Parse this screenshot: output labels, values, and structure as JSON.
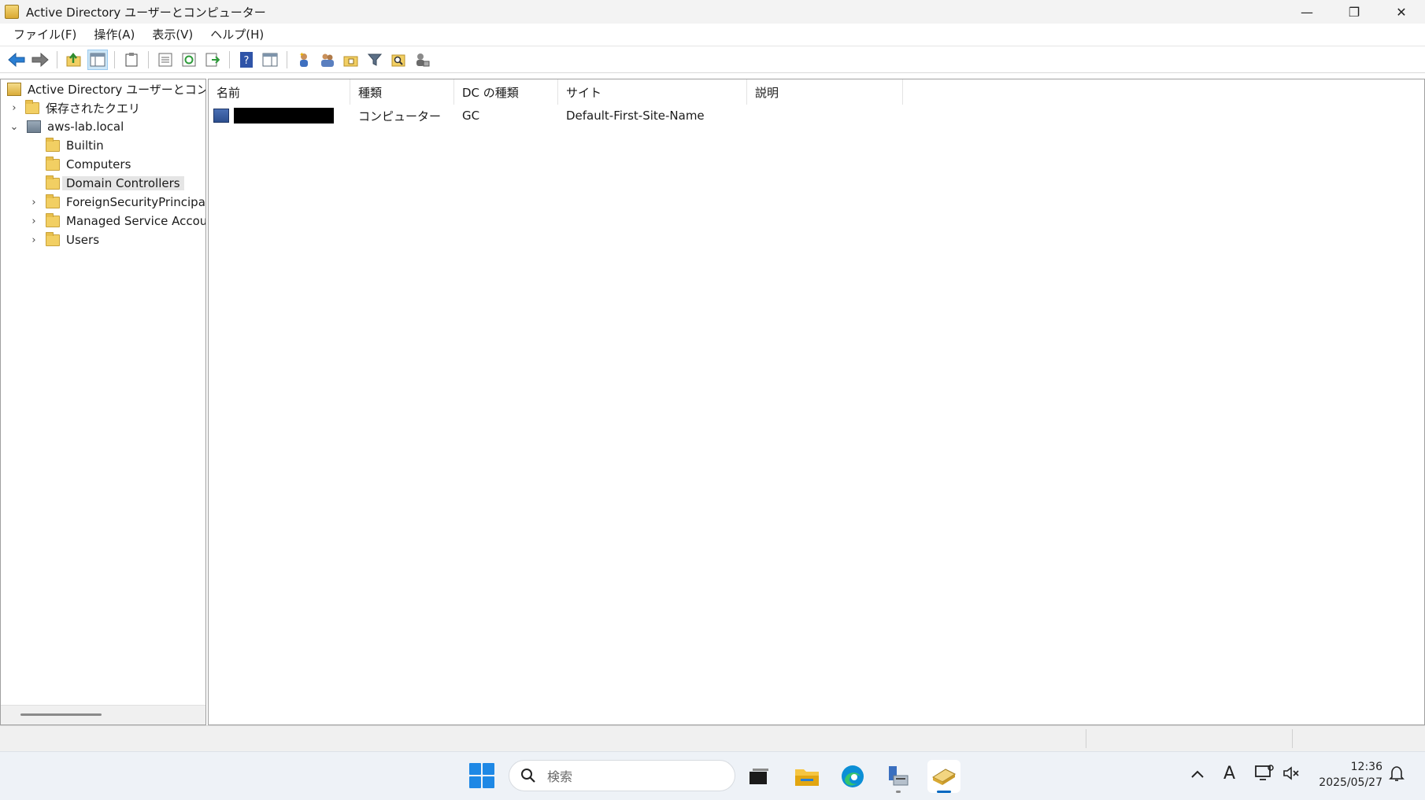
{
  "window": {
    "title": "Active Directory ユーザーとコンピューター",
    "minimize_glyph": "—",
    "restore_glyph": "❐",
    "close_glyph": "✕"
  },
  "menu": [
    "ファイル(F)",
    "操作(A)",
    "表示(V)",
    "ヘルプ(H)"
  ],
  "toolbar_icons": [
    "back-icon",
    "forward-icon",
    "up-icon",
    "show-hide-console-tree-icon",
    "clipboard-icon",
    "properties-icon",
    "refresh-icon",
    "export-list-icon",
    "help-icon",
    "console-tree-icon",
    "new-user-icon",
    "new-group-icon",
    "new-ou-icon",
    "filter-icon",
    "find-icon",
    "delegate-icon"
  ],
  "tree": {
    "root": "Active Directory ユーザーとコンピュー",
    "saved_queries": "保存されたクエリ",
    "domain": "aws-lab.local",
    "children": [
      "Builtin",
      "Computers",
      "Domain Controllers",
      "ForeignSecurityPrincipals",
      "Managed Service Accour",
      "Users"
    ],
    "selected": "Domain Controllers"
  },
  "list": {
    "columns": [
      "名前",
      "種類",
      "DC の種類",
      "サイト",
      "説明"
    ],
    "rows": [
      {
        "name": "",
        "type": "コンピューター",
        "dc_type": "GC",
        "site": "Default-First-Site-Name",
        "description": ""
      }
    ]
  },
  "taskbar": {
    "search_placeholder": "検索",
    "time": "12:36",
    "date": "2025/05/27",
    "ime": "A"
  },
  "colors": {
    "accent": "#0067c0",
    "selection": "#e5e5e5"
  }
}
